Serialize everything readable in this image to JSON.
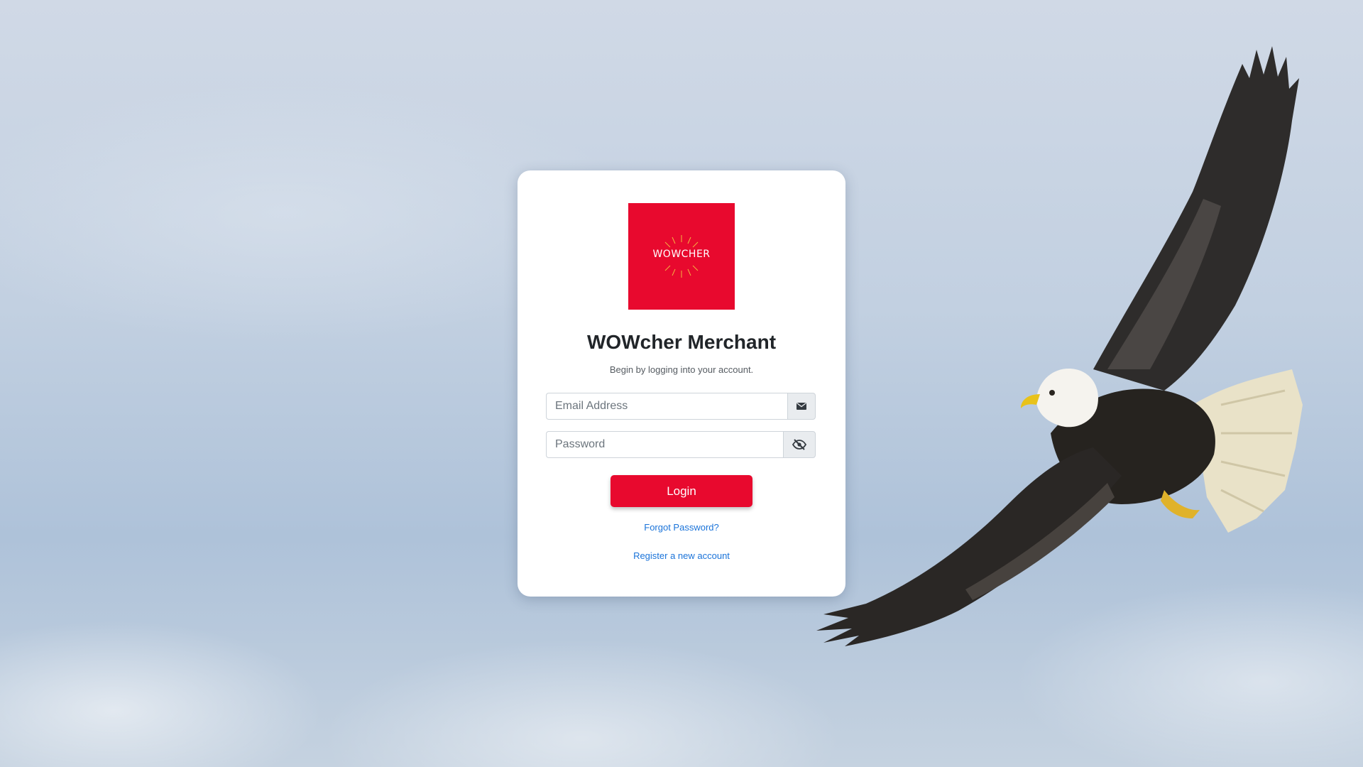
{
  "logo": {
    "text": "WOWCHER",
    "background_color": "#e8092e",
    "ray_color": "#f5c542"
  },
  "login_card": {
    "title": "WOWcher Merchant",
    "subtitle": "Begin by logging into your account."
  },
  "email": {
    "placeholder": "Email Address",
    "value": "",
    "icon": "envelope-icon"
  },
  "password": {
    "placeholder": "Password",
    "value": "",
    "icon": "eye-slash-icon"
  },
  "actions": {
    "login_label": "Login",
    "forgot_password_label": "Forgot Password?",
    "register_label": "Register a new account"
  },
  "colors": {
    "accent": "#e8092e",
    "link": "#1a73d9"
  }
}
